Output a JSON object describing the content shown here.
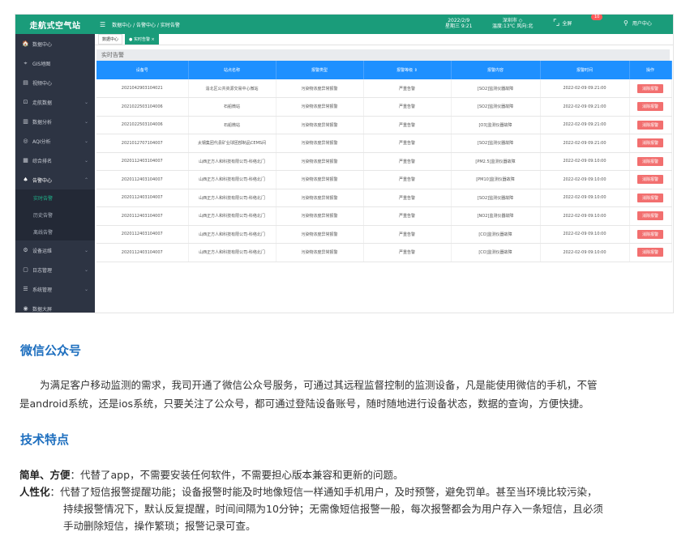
{
  "app": {
    "logo": "走航式空气站",
    "breadcrumb": "数据中心 / 告警中心 / 实时告警",
    "date_line1": "2022/2/9",
    "date_line2": "星期三 9:21",
    "weather_line1": "深圳市 ◇",
    "weather_line2": "温度:13℃ 风向:北",
    "fullscreen_label": "全屏",
    "notification_count": "10",
    "user_label": "用户中心",
    "tabs": [
      "数据中心",
      "● 实时告警 ×"
    ],
    "panel_title": "实时告警",
    "menu": [
      {
        "icon": "🏠",
        "label": "数据中心",
        "chev": ""
      },
      {
        "icon": "⌖",
        "label": "GIS地图",
        "chev": ""
      },
      {
        "icon": "▤",
        "label": "视频中心",
        "chev": ""
      },
      {
        "icon": "⊡",
        "label": "走航数据",
        "chev": "⌄"
      },
      {
        "icon": "▥",
        "label": "数据分析",
        "chev": "⌄"
      },
      {
        "icon": "◎",
        "label": "AQI分析",
        "chev": "⌄"
      },
      {
        "icon": "▦",
        "label": "综合排名",
        "chev": "⌄"
      },
      {
        "icon": "♠",
        "label": "告警中心",
        "chev": "⌃"
      }
    ],
    "submenu": [
      "实时告警",
      "历史告警",
      "离线告警"
    ],
    "menu_bottom": [
      {
        "icon": "⚙",
        "label": "设备运维",
        "chev": "⌄"
      },
      {
        "icon": "▢",
        "label": "日志管理",
        "chev": "⌄"
      },
      {
        "icon": "☰",
        "label": "系统管理",
        "chev": "⌄"
      },
      {
        "icon": "◉",
        "label": "数据大屏",
        "chev": ""
      }
    ],
    "table": {
      "headers": [
        "设备号",
        "站点名称",
        "报警类型",
        "报警等级 ⇕",
        "报警内容",
        "报警时间",
        "操作"
      ],
      "action_label": "消除报警",
      "rows": [
        [
          "2021042903104021",
          "渝北区公共资源交易中心微站",
          "污染物浓度异常报警",
          "严重告警",
          "[SO2]监测仪器故障",
          "2022-02-09 09:21:00"
        ],
        [
          "2021022503104006",
          "石船微站",
          "污染物浓度异常报警",
          "严重告警",
          "[SO2]监测仪器故障",
          "2022-02-09 09:21:00"
        ],
        [
          "2021022503104006",
          "石船微站",
          "污染物浓度异常报警",
          "严重告警",
          "[O3]监测仪器故障",
          "2022-02-09 09:21:00"
        ],
        [
          "2021012707104007",
          "太钢集团代县矿业球团部制品CEMS间",
          "污染物浓度异常报警",
          "严重告警",
          "[SO2]监测仪器故障",
          "2022-02-09 09:21:00"
        ],
        [
          "2020112403104007",
          "山西正方人和科技有限公司-科络北门",
          "污染物浓度异常报警",
          "严重告警",
          "[PM2.5]监测仪器故障",
          "2022-02-09 09:10:00"
        ],
        [
          "2020112403104007",
          "山西正方人和科技有限公司-科络北门",
          "污染物浓度异常报警",
          "严重告警",
          "[PM10]监测仪器故障",
          "2022-02-09 09:10:00"
        ],
        [
          "2020112403104007",
          "山西正方人和科技有限公司-科络北门",
          "污染物浓度异常报警",
          "严重告警",
          "[SO2]监测仪器故障",
          "2022-02-09 09:10:00"
        ],
        [
          "2020112403104007",
          "山西正方人和科技有限公司-科络北门",
          "污染物浓度异常报警",
          "严重告警",
          "[NO2]监测仪器故障",
          "2022-02-09 09:10:00"
        ],
        [
          "2020112403104007",
          "山西正方人和科技有限公司-科络北门",
          "污染物浓度异常报警",
          "严重告警",
          "[CO]监测仪器故障",
          "2022-02-09 09:10:00"
        ],
        [
          "2020112403104007",
          "山西正方人和科技有限公司-科络北门",
          "污染物浓度异常报警",
          "严重告警",
          "[CO]监测仪器故障",
          "2022-02-09 09:10:00"
        ]
      ]
    }
  },
  "article": {
    "wechat_title": "微信公众号",
    "wechat_body_1": "　　为满足客户移动监测的需求，我司开通了微信公众号服务，可通过其远程监督控制的监测设备，凡是能使用微信的手机，不管",
    "wechat_body_2": "是android系统，还是ios系统，只要关注了公众号，都可通过登陆设备账号，随时随地进行设备状态，数据的查询，方便快捷。",
    "tech_title": "技术特点",
    "feat1_label": "简单、方便",
    "feat1_text": "：代替了app，不需要安装任何软件，不需要担心版本兼容和更新的问题。",
    "feat2_label": "人性化",
    "feat2_line1": "：代替了短信报警提醒功能；设备报警时能及时地像短信一样通知手机用户，及时预警，避免罚单。甚至当环境比较污染，",
    "feat2_line2": "持续报警情况下，默认反复提醒，时间间隔为10分钟；无需像短信报警一般，每次报警都会为用户存入一条短信，且必须",
    "feat2_line3": "手动删除短信，操作繁琐；报警记录可查。"
  },
  "colors": {
    "brand": "#1a9c7a",
    "table_header": "#1e90ff",
    "danger": "#f26f6f",
    "heading": "#1e6fbf"
  }
}
